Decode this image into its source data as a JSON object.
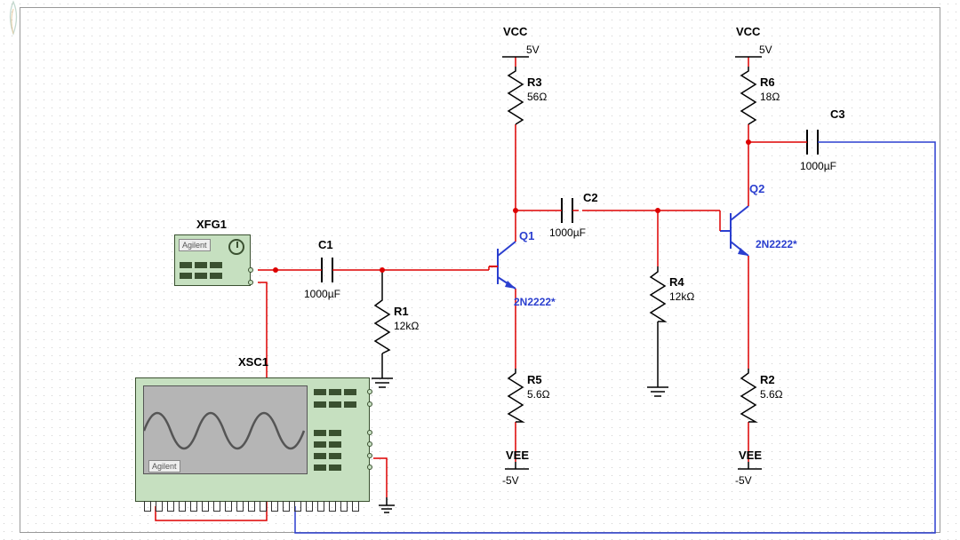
{
  "instruments": {
    "xfg1": {
      "label": "XFG1",
      "brand": "Agilent"
    },
    "xsc1": {
      "label": "XSC1",
      "brand": "Agilent"
    }
  },
  "rails": {
    "vcc1": {
      "name": "VCC",
      "value": "5V"
    },
    "vcc2": {
      "name": "VCC",
      "value": "5V"
    },
    "vee1": {
      "name": "VEE",
      "value": "-5V"
    },
    "vee2": {
      "name": "VEE",
      "value": "-5V"
    }
  },
  "components": {
    "c1": {
      "ref": "C1",
      "value": "1000µF"
    },
    "c2": {
      "ref": "C2",
      "value": "1000µF"
    },
    "c3": {
      "ref": "C3",
      "value": "1000µF"
    },
    "r1": {
      "ref": "R1",
      "value": "12kΩ"
    },
    "r3": {
      "ref": "R3",
      "value": "56Ω"
    },
    "r4": {
      "ref": "R4",
      "value": "12kΩ"
    },
    "r5": {
      "ref": "R5",
      "value": "5.6Ω"
    },
    "r6": {
      "ref": "R6",
      "value": "18Ω"
    },
    "r2": {
      "ref": "R2",
      "value": "5.6Ω"
    },
    "q1": {
      "ref": "Q1",
      "model": "2N2222*"
    },
    "q2": {
      "ref": "Q2",
      "model": "2N2222*"
    }
  }
}
